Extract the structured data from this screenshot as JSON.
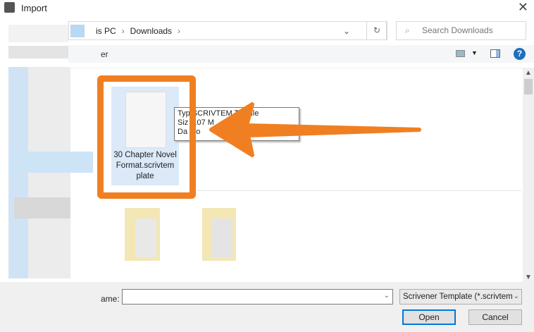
{
  "window": {
    "title": "Import",
    "close": "✕"
  },
  "address": {
    "crumbs": [
      "is PC",
      "Downloads"
    ],
    "separator": "›",
    "dropdown": "⌄",
    "refresh": "↻"
  },
  "search": {
    "placeholder": "Search Downloads",
    "icon": "⌕"
  },
  "toolbar": {
    "partial_label": "er",
    "help": "?"
  },
  "file": {
    "name": "30 Chapter Novel Format.scrivtemplate",
    "name_lines": [
      "30 Chapter Novel",
      "Format.scrivtem",
      "plate"
    ]
  },
  "tooltip": {
    "lines": [
      "Typ  SCRIVTEM    TE File",
      "Siz  1.07 M",
      "Da   mo"
    ]
  },
  "footer": {
    "filename_label": "ame:",
    "filename_value": "",
    "filter": "Scrivener Template (*.scrivtemp",
    "open": "Open",
    "cancel": "Cancel"
  },
  "colors": {
    "annotation": "#f07f22",
    "accent": "#0078d7"
  }
}
